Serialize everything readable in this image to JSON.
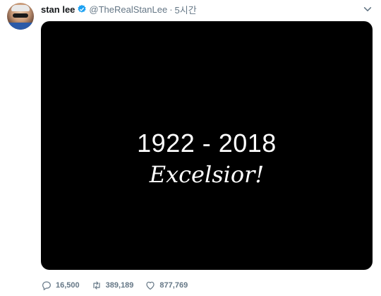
{
  "tweet": {
    "author": {
      "name": "stan lee",
      "handle": "@TheRealStanLee",
      "separator": "·",
      "time": "5시간"
    },
    "media": {
      "years": "1922 - 2018",
      "motto": "Excelsior!"
    },
    "actions": {
      "replies": "16,500",
      "retweets": "389,189",
      "likes": "877,769"
    }
  },
  "colors": {
    "verified": "#1da1f2",
    "muted": "#657786",
    "media_bg": "#000000"
  },
  "icons": [
    "verified-badge-icon",
    "chevron-down-icon",
    "reply-icon",
    "retweet-icon",
    "like-icon"
  ]
}
